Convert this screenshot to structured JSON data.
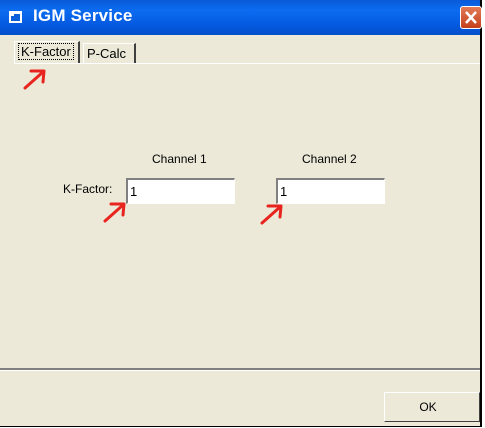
{
  "window": {
    "title": "IGM Service",
    "close_icon": "close-icon"
  },
  "tabs": [
    {
      "label": "K-Factor",
      "selected": true
    },
    {
      "label": "P-Calc",
      "selected": false
    }
  ],
  "form": {
    "row_label": "K-Factor:",
    "channels": [
      {
        "header": "Channel 1",
        "value": "1"
      },
      {
        "header": "Channel 2",
        "value": "1"
      }
    ]
  },
  "footer": {
    "ok_label": "OK"
  },
  "annotations": {
    "arrow_color": "#e8241e",
    "arrow_icon": "red-annotation-arrow-icon"
  }
}
